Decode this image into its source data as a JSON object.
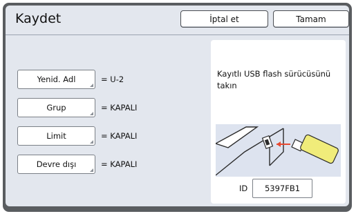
{
  "header": {
    "title": "Kaydet",
    "cancel_label": "İptal et",
    "ok_label": "Tamam"
  },
  "settings": [
    {
      "label": "Yenid. Adl",
      "value": "= U-2"
    },
    {
      "label": "Grup",
      "value": "= KAPALI"
    },
    {
      "label": "Limit",
      "value": "= KAPALI"
    },
    {
      "label": "Devre dışı",
      "value": "= KAPALI"
    }
  ],
  "panel": {
    "message": "Kayıtlı USB flash sürücüsünü takın",
    "illustration_icon": "usb-insert-illustration",
    "id_label": "ID",
    "id_value": "5397FB1"
  },
  "colors": {
    "frame": "#5a5d60",
    "background": "#e3e7ee",
    "usb_body": "#f0ec7a",
    "arrow": "#e8482f",
    "illustration_bg": "#dde3ef"
  }
}
